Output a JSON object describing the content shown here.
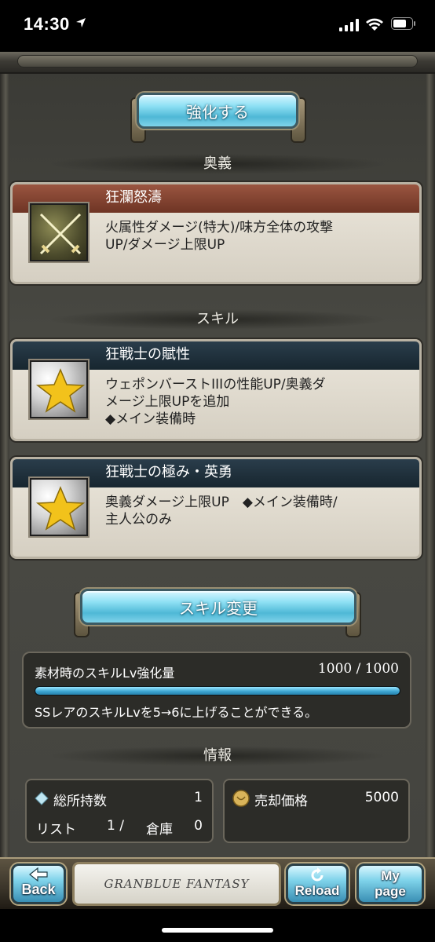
{
  "status_bar": {
    "time": "14:30"
  },
  "buttons": {
    "enhance": "強化する",
    "skill_change": "スキル変更"
  },
  "sections": {
    "ougi": "奥義",
    "skill": "スキル",
    "info": "情報"
  },
  "ougi_card": {
    "name": "狂瀾怒濤",
    "desc_line1": "火属性ダメージ(特大)/味方全体の攻撃",
    "desc_line2": "UP/ダメージ上限UP"
  },
  "skill_cards": [
    {
      "name": "狂戦士の賦性",
      "desc_line1": "ウェポンバーストIIIの性能UP/奥義ダ",
      "desc_line2": "メージ上限UPを追加",
      "desc_line3": "◆メイン装備時"
    },
    {
      "name": "狂戦士の極み・英勇",
      "desc_line1": "奥義ダメージ上限UP　◆メイン装備時/",
      "desc_line2": "主人公のみ"
    }
  ],
  "skill_lv_panel": {
    "label": "素材時のスキルLv強化量",
    "value": "1000 / 1000",
    "fill": 1.0,
    "desc": "SSレアのスキルLvを5→6に上げることができる。"
  },
  "info": {
    "total_label": "総所持数",
    "total_value": "1",
    "list_label": "リスト",
    "list_value": "1 /",
    "storage_label": "倉庫",
    "storage_value": "0",
    "sell_label": "売却価格",
    "sell_value": "5000"
  },
  "nav": {
    "back": "Back",
    "logo": "GRANBLUE FANTASY",
    "reload": "Reload",
    "my_line1": "My",
    "my_line2": "page"
  }
}
